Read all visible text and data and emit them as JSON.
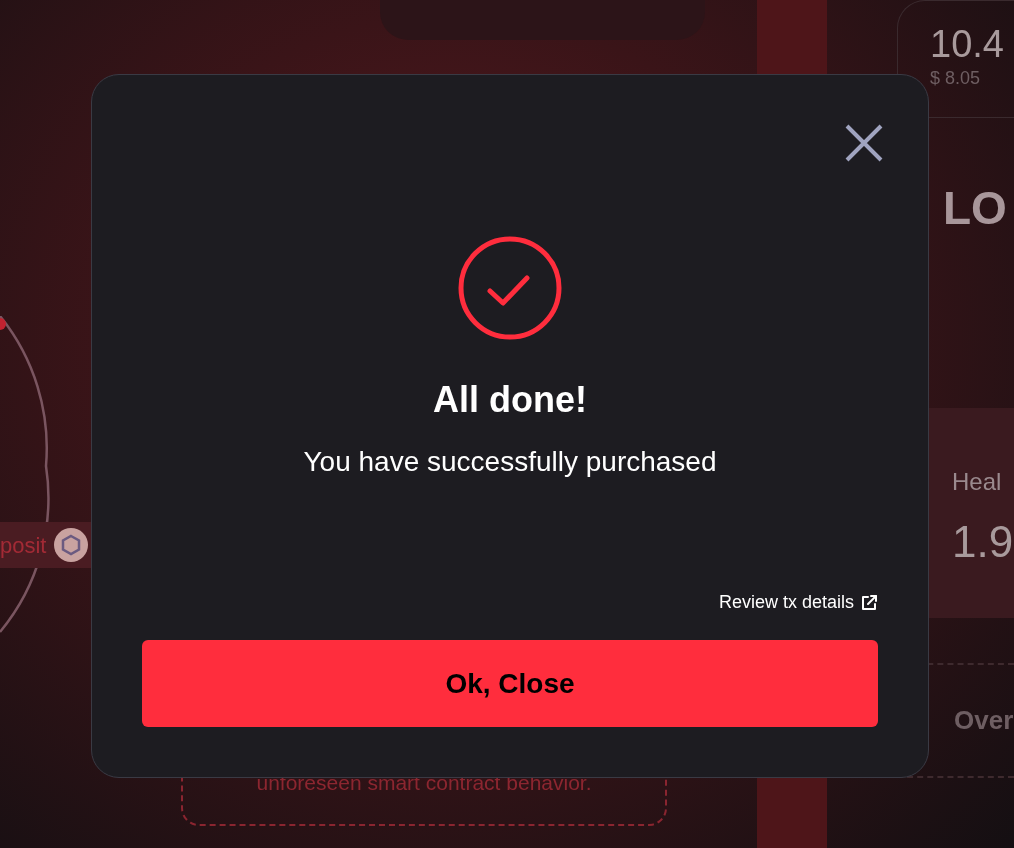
{
  "background": {
    "deposit_label": "posit",
    "warning": "unforeseen smart contract behavior.",
    "balance": "10.4",
    "balance_usd": "$ 8.05",
    "heading": "LO",
    "health_label": "Heal",
    "health_value": "1.9",
    "overview_label": "Over"
  },
  "modal": {
    "title": "All done!",
    "message": "You have successfully purchased",
    "link": "Review tx details",
    "button": "Ok, Close"
  }
}
